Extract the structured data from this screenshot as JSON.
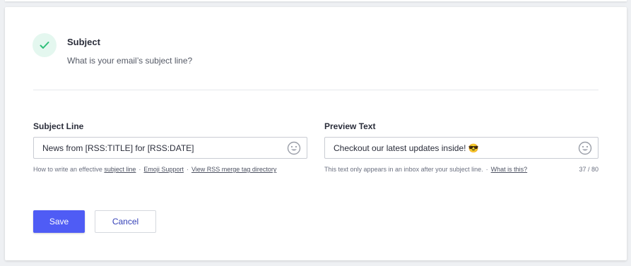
{
  "step": {
    "title": "Subject",
    "description": "What is your email’s subject line?",
    "status_icon": "check-icon"
  },
  "subject_field": {
    "label": "Subject Line",
    "value": "News from [RSS:TITLE] for [RSS:DATE]",
    "emoji_icon": "smiley-icon",
    "help_prefix": "How to write an effective ",
    "help_link_1": "subject line",
    "sep_1": "·",
    "help_link_2": "Emoji Support",
    "sep_2": "·",
    "help_link_3": "View RSS merge tag directory"
  },
  "preview_field": {
    "label": "Preview Text",
    "value": "Checkout our latest updates inside! 😎",
    "emoji_icon": "smiley-icon",
    "help_text": "This text only appears in an inbox after your subject line.",
    "sep": "·",
    "help_link": "What is this?",
    "counter": "37 / 80"
  },
  "actions": {
    "save_label": "Save",
    "cancel_label": "Cancel"
  },
  "colors": {
    "primary": "#4f5cf5",
    "success_bg": "#e4f7ef",
    "success": "#2fbf7a"
  }
}
